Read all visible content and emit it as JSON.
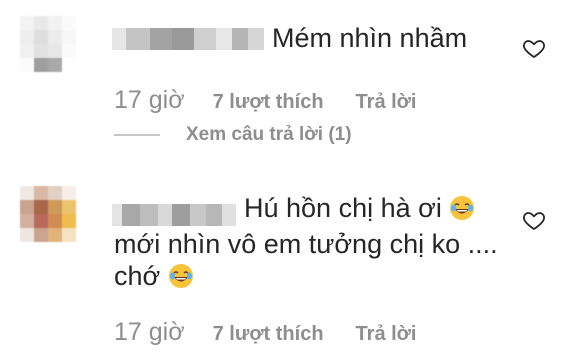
{
  "comments": [
    {
      "text_line1": "Mém nhìn nhầm",
      "time": "17 giờ",
      "likes": "7 lượt thích",
      "reply_label": "Trả lời",
      "view_replies": "Xem câu trả lời (1)"
    },
    {
      "text_line1": "Hú hồn chị hà ơi",
      "text_line2": "mới nhìn vô em tưởng chị ko ....",
      "text_line3": "chớ",
      "time": "17 giờ",
      "likes": "7 lượt thích",
      "reply_label": "Trả lời"
    }
  ],
  "icons": {
    "like": "heart-outline-icon",
    "emoji": "face-with-tears-of-joy"
  },
  "colors": {
    "text": "#262626",
    "meta": "#8e8e8e",
    "divider": "#c7c7c7"
  }
}
